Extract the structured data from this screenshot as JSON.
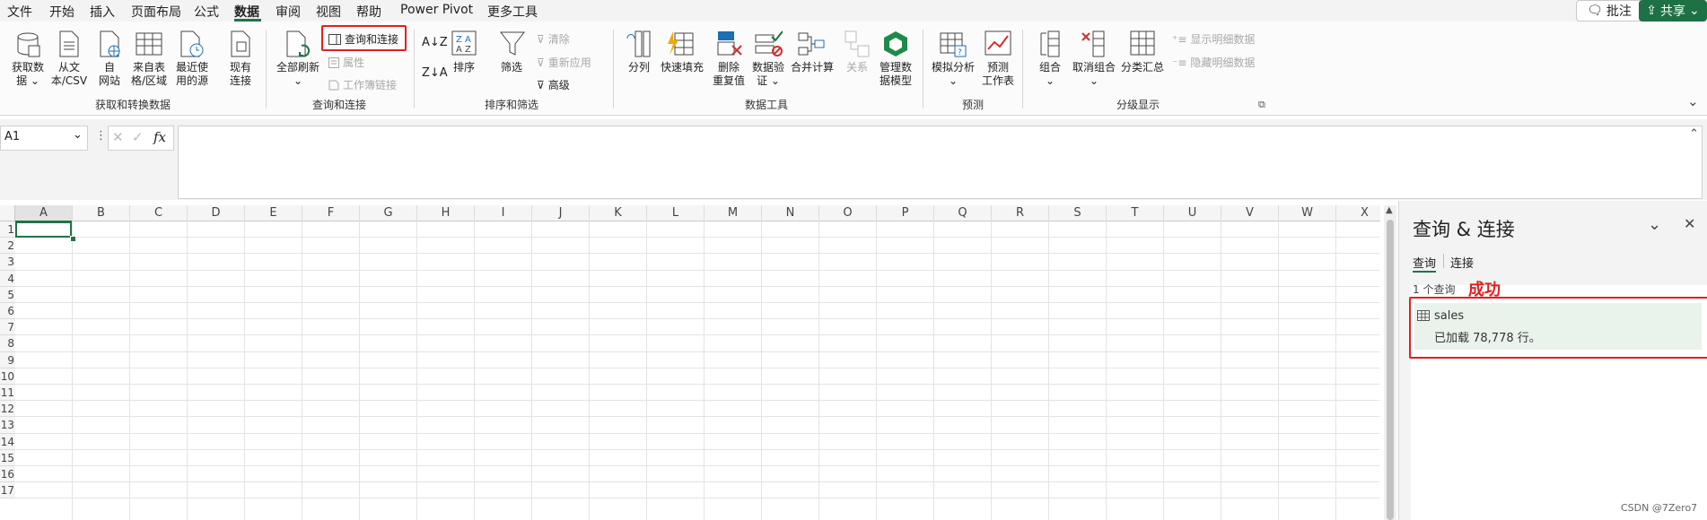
{
  "menu": {
    "items": [
      "文件",
      "开始",
      "插入",
      "页面布局",
      "公式",
      "数据",
      "审阅",
      "视图",
      "帮助",
      "Power Pivot",
      "更多工具"
    ],
    "active": "数据",
    "comments_label": "批注",
    "share_label": "共享"
  },
  "ribbon": {
    "get_data": {
      "label_l1": "获取数",
      "label_l2": "据 ⌄"
    },
    "from_text_csv": {
      "label_l1": "从文",
      "label_l2": "本/CSV"
    },
    "from_web": {
      "label_l1": "自",
      "label_l2": "网站"
    },
    "from_table": {
      "label_l1": "来自表",
      "label_l2": "格/区域"
    },
    "recent_sources": {
      "label_l1": "最近使",
      "label_l2": "用的源"
    },
    "existing_connections": {
      "label_l1": "现有",
      "label_l2": "连接"
    },
    "group_get_transform": "获取和转换数据",
    "refresh_all": {
      "label_l1": "全部刷新",
      "label_l2": "⌄"
    },
    "queries_connections": "查询和连接",
    "properties": "属性",
    "workbook_links": "工作簿链接",
    "group_queries": "查询和连接",
    "sort": "排序",
    "filter": "筛选",
    "clear": "清除",
    "reapply": "重新应用",
    "advanced": "高级",
    "group_sort_filter": "排序和筛选",
    "text_to_columns": "分列",
    "flash_fill": "快速填充",
    "remove_dup": {
      "label_l1": "删除",
      "label_l2": "重复值"
    },
    "data_validation": {
      "label_l1": "数据验",
      "label_l2": "证 ⌄"
    },
    "consolidate": "合并计算",
    "relationships": "关系",
    "data_model": {
      "label_l1": "管理数",
      "label_l2": "据模型"
    },
    "group_data_tools": "数据工具",
    "what_if": "模拟分析",
    "forecast_sheet": {
      "label_l1": "预测",
      "label_l2": "工作表"
    },
    "group_forecast": "预测",
    "group_btn": {
      "label_l1": "组合",
      "label_l2": "⌄"
    },
    "ungroup": {
      "label_l1": "取消组合",
      "label_l2": "⌄"
    },
    "subtotal": "分类汇总",
    "show_detail": "显示明细数据",
    "hide_detail": "隐藏明细数据",
    "group_outline": "分级显示"
  },
  "formula_bar": {
    "namebox": "A1",
    "fx": "fx",
    "value": ""
  },
  "grid": {
    "columns": [
      "A",
      "B",
      "C",
      "D",
      "E",
      "F",
      "G",
      "H",
      "I",
      "J",
      "K",
      "L",
      "M",
      "N",
      "O",
      "P",
      "Q",
      "R",
      "S",
      "T",
      "U",
      "V",
      "W",
      "X"
    ],
    "rows": [
      "1",
      "2",
      "3",
      "4",
      "5",
      "6",
      "7",
      "8",
      "9",
      "10",
      "11",
      "12",
      "13",
      "14",
      "15",
      "16",
      "17"
    ]
  },
  "pane": {
    "title": "查询 & 连接",
    "tab_queries": "查询",
    "tab_connections": "连接",
    "count": "1 个查询",
    "annotation": "成功",
    "query_name": "sales",
    "query_status": "已加载 78,778 行。"
  },
  "watermark": "CSDN @7Zero7",
  "colors": {
    "accent": "#217346",
    "highlight": "#e02020",
    "query_bg": "#e9f3ec"
  }
}
